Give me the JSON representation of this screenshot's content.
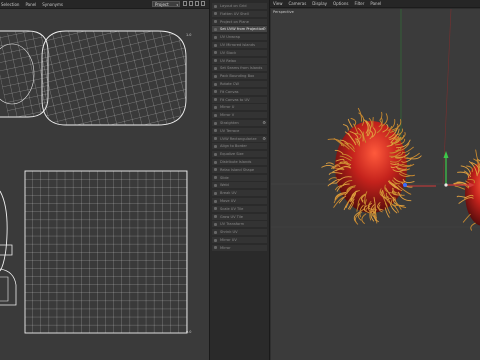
{
  "uv_editor": {
    "menu": [
      "Selection",
      "Panel",
      "Synonyms"
    ],
    "projection": "Project",
    "coord_top_right": "1.0",
    "coord_bottom_right": "0.0"
  },
  "tools": {
    "items": [
      {
        "label": "Layout on Grid",
        "active": false,
        "gear": false
      },
      {
        "label": "Flatten UV Shell",
        "active": false,
        "gear": false
      },
      {
        "label": "Project on Plane",
        "active": false,
        "gear": false
      },
      {
        "label": "Set UVW from Projection",
        "active": true,
        "gear": true
      },
      {
        "label": "UV Unwrap",
        "active": false,
        "gear": false
      },
      {
        "label": "UV Mirrored Islands",
        "active": false,
        "gear": false
      },
      {
        "label": "UV Stack",
        "active": false,
        "gear": false
      },
      {
        "label": "UV Relax",
        "active": false,
        "gear": false
      },
      {
        "label": "Set Seams from Islands",
        "active": false,
        "gear": false
      },
      {
        "label": "Pack Bounding Box",
        "active": false,
        "gear": false
      },
      {
        "label": "Rotate CW",
        "active": false,
        "gear": false
      },
      {
        "label": "Fit Canvas",
        "active": false,
        "gear": false
      },
      {
        "label": "Fit Canvas to UV",
        "active": false,
        "gear": false
      },
      {
        "label": "Mirror U",
        "active": false,
        "gear": false
      },
      {
        "label": "Mirror V",
        "active": false,
        "gear": false
      },
      {
        "label": "Straighten",
        "active": false,
        "gear": true
      },
      {
        "label": "UV Terrace",
        "active": false,
        "gear": false
      },
      {
        "label": "UVW Rectangularize",
        "active": false,
        "gear": true
      },
      {
        "label": "Align to Border",
        "active": false,
        "gear": false
      },
      {
        "label": "Equalize Size",
        "active": false,
        "gear": false
      },
      {
        "label": "Distribute Islands",
        "active": false,
        "gear": false
      },
      {
        "label": "Relax Island Shape",
        "active": false,
        "gear": false
      },
      {
        "label": "Slide",
        "active": false,
        "gear": false
      },
      {
        "label": "Weld",
        "active": false,
        "gear": false
      },
      {
        "label": "Break UV",
        "active": false,
        "gear": false
      },
      {
        "label": "Move UV",
        "active": false,
        "gear": false
      },
      {
        "label": "Scale UV Tile",
        "active": false,
        "gear": false
      },
      {
        "label": "Grow UV Tile",
        "active": false,
        "gear": false
      },
      {
        "label": "UV Transform",
        "active": false,
        "gear": false
      },
      {
        "label": "Shrink UV",
        "active": false,
        "gear": false
      },
      {
        "label": "Mirror UV",
        "active": false,
        "gear": false
      },
      {
        "label": "Mirror",
        "active": false,
        "gear": false
      }
    ]
  },
  "viewport": {
    "menu": [
      "View",
      "Cameras",
      "Display",
      "Options",
      "Filter",
      "Panel"
    ],
    "camera_label": "Perspective"
  },
  "colors": {
    "uv_background": "#3a3a3a",
    "viewport_background": "#3b3b3b",
    "uv_lines": "#e6e6e6",
    "fruit_red": "#c4221c",
    "hair_orange": "#e0a040",
    "axis_green": "#3cc84a",
    "axis_blue": "#3a6cff",
    "axis_red": "#d23a3a"
  }
}
